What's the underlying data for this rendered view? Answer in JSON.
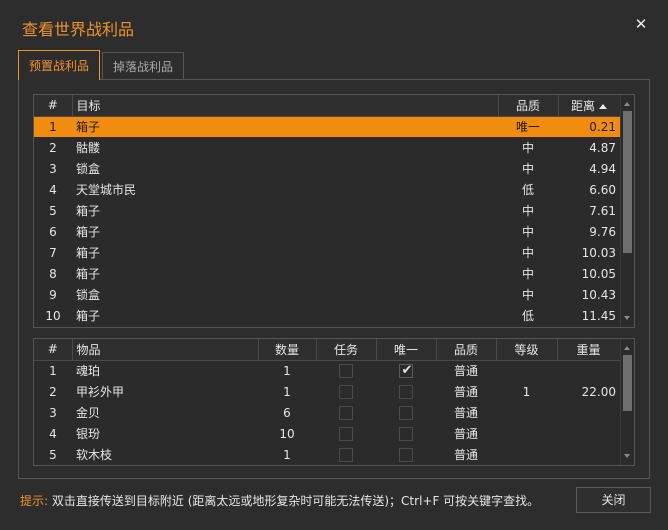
{
  "window": {
    "title": "查看世界战利品"
  },
  "tabs": [
    {
      "label": "预置战利品",
      "active": true
    },
    {
      "label": "掉落战利品",
      "active": false
    }
  ],
  "targets": {
    "columns": [
      "#",
      "目标",
      "品质",
      "距离"
    ],
    "sort_column": "距离",
    "sort_direction": "ascending",
    "rows": [
      {
        "num": "1",
        "name": "箱子",
        "quality": "唯一",
        "distance": "0.21",
        "selected": true
      },
      {
        "num": "2",
        "name": "骷髅",
        "quality": "中",
        "distance": "4.87"
      },
      {
        "num": "3",
        "name": "锁盒",
        "quality": "中",
        "distance": "4.94"
      },
      {
        "num": "4",
        "name": "天堂城市民",
        "quality": "低",
        "distance": "6.60"
      },
      {
        "num": "5",
        "name": "箱子",
        "quality": "中",
        "distance": "7.61"
      },
      {
        "num": "6",
        "name": "箱子",
        "quality": "中",
        "distance": "9.76"
      },
      {
        "num": "7",
        "name": "箱子",
        "quality": "中",
        "distance": "10.03"
      },
      {
        "num": "8",
        "name": "箱子",
        "quality": "中",
        "distance": "10.05"
      },
      {
        "num": "9",
        "name": "锁盒",
        "quality": "中",
        "distance": "10.43"
      },
      {
        "num": "10",
        "name": "箱子",
        "quality": "低",
        "distance": "11.45"
      }
    ]
  },
  "items": {
    "columns": [
      "#",
      "物品",
      "数量",
      "任务",
      "唯一",
      "品质",
      "等级",
      "重量"
    ],
    "rows": [
      {
        "num": "1",
        "name": "魂珀",
        "count": "1",
        "quest": false,
        "unique": true,
        "quality": "普通",
        "level": "",
        "weight": ""
      },
      {
        "num": "2",
        "name": "甲衫外甲",
        "count": "1",
        "quest": false,
        "unique": false,
        "quality": "普通",
        "level": "1",
        "weight": "22.00"
      },
      {
        "num": "3",
        "name": "金贝",
        "count": "6",
        "quest": false,
        "unique": false,
        "quality": "普通",
        "level": "",
        "weight": ""
      },
      {
        "num": "4",
        "name": "银玢",
        "count": "10",
        "quest": false,
        "unique": false,
        "quality": "普通",
        "level": "",
        "weight": ""
      },
      {
        "num": "5",
        "name": "软木枝",
        "count": "1",
        "quest": false,
        "unique": false,
        "quality": "普通",
        "level": "",
        "weight": ""
      }
    ]
  },
  "footer": {
    "hint_label": "提示:",
    "hint_text": "双击直接传送到目标附近 (距离太远或地形复杂时可能无法传送)；Ctrl+F 可按关键字查找。",
    "close_button": "关闭"
  },
  "colors": {
    "accent": "#f0932b",
    "selected_row": "#f28c0f",
    "background": "#2d2d2d"
  },
  "icons": {
    "close": "close-icon",
    "sort": "sort-ascending-icon",
    "check": "checkmark-icon"
  }
}
